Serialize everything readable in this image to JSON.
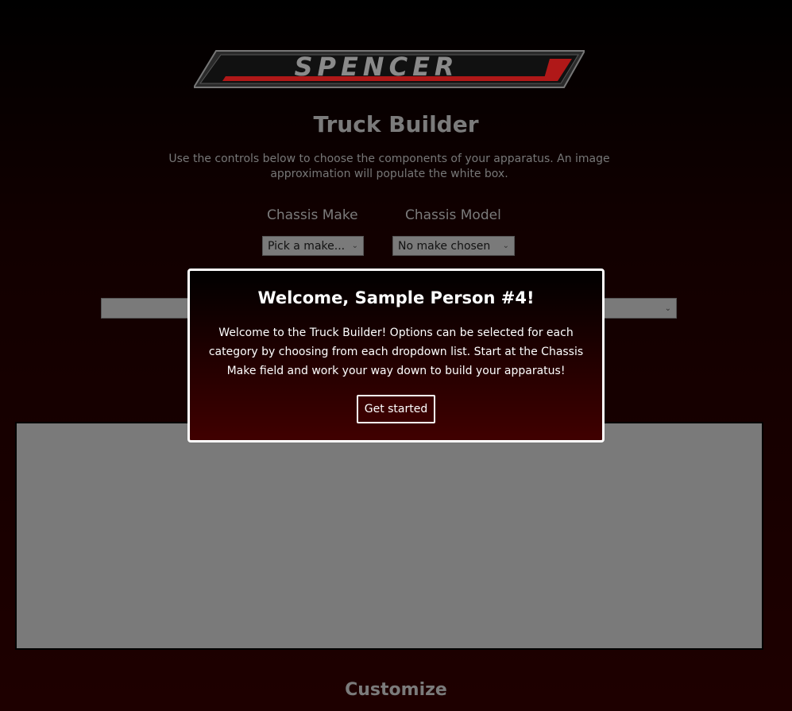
{
  "logo": {
    "text": "SPENCER"
  },
  "title": "Truck Builder",
  "description": "Use the controls below to choose the components of your apparatus. An image approximation will populate the white box.",
  "chassis_make": {
    "label": "Chassis Make",
    "value": "Pick a make..."
  },
  "chassis_model": {
    "label": "Chassis Model",
    "value": "No make chosen"
  },
  "modal": {
    "title": "Welcome, Sample Person #4!",
    "body": "Welcome to the Truck Builder! Options can be selected for each category by choosing from each dropdown list. Start at the Chassis Make field and work your way down to build your apparatus!",
    "button": "Get started"
  },
  "customize": "Customize"
}
